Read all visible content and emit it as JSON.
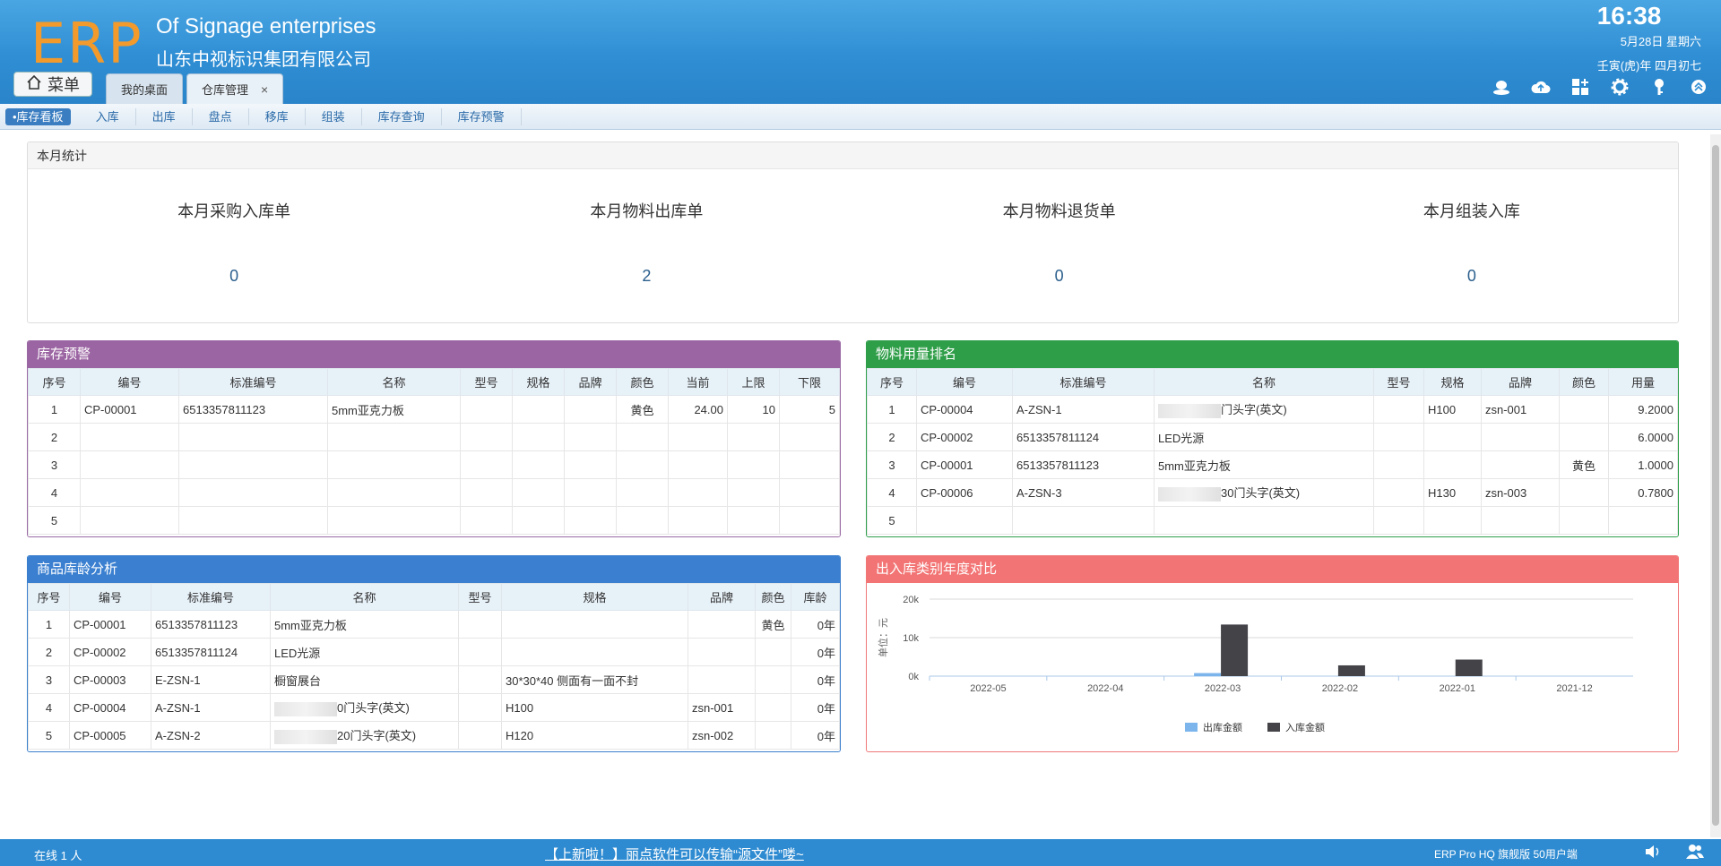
{
  "header": {
    "logo": "ERP",
    "company_en": "Of Signage enterprises",
    "company_cn": "山东中视标识集团有限公司",
    "time": "16:38",
    "date": "5月28日 星期六",
    "lunar": "壬寅(虎)年 四月初七",
    "menu_label": "菜单",
    "tabs": [
      {
        "label": "我的桌面"
      },
      {
        "label": "仓库管理",
        "close": "×"
      }
    ],
    "tool_icons": [
      "user-icon",
      "cloud-upload-icon",
      "grid-plus-icon",
      "gear-icon",
      "key-icon",
      "collapse-icon"
    ]
  },
  "subnav": {
    "items": [
      "•库存看板",
      "入库",
      "出库",
      "盘点",
      "移库",
      "组装",
      "库存查询",
      "库存预警"
    ]
  },
  "stats": {
    "title": "本月统计",
    "items": [
      {
        "label": "本月采购入库单",
        "value": "0"
      },
      {
        "label": "本月物料出库单",
        "value": "2"
      },
      {
        "label": "本月物料退货单",
        "value": "0"
      },
      {
        "label": "本月组装入库",
        "value": "0"
      }
    ]
  },
  "warning": {
    "title": "库存预警",
    "headers": [
      "序号",
      "编号",
      "标准编号",
      "名称",
      "型号",
      "规格",
      "品牌",
      "颜色",
      "当前",
      "上限",
      "下限"
    ],
    "rows": [
      [
        "1",
        "CP-00001",
        "6513357811123",
        "5mm亚克力板",
        "",
        "",
        "",
        "黄色",
        "24.00",
        "10",
        "5"
      ],
      [
        "2",
        "",
        "",
        "",
        "",
        "",
        "",
        "",
        "",
        "",
        ""
      ],
      [
        "3",
        "",
        "",
        "",
        "",
        "",
        "",
        "",
        "",
        "",
        ""
      ],
      [
        "4",
        "",
        "",
        "",
        "",
        "",
        "",
        "",
        "",
        "",
        ""
      ],
      [
        "5",
        "",
        "",
        "",
        "",
        "",
        "",
        "",
        "",
        "",
        ""
      ]
    ]
  },
  "ranking": {
    "title": "物料用量排名",
    "headers": [
      "序号",
      "编号",
      "标准编号",
      "名称",
      "型号",
      "规格",
      "品牌",
      "颜色",
      "用量"
    ],
    "rows": [
      [
        "1",
        "CP-00004",
        "A-ZSN-1",
        "门头字(英文)",
        "",
        "H100",
        "zsn-001",
        "",
        "9.2000"
      ],
      [
        "2",
        "CP-00002",
        "6513357811124",
        "LED光源",
        "",
        "",
        "",
        "",
        "6.0000"
      ],
      [
        "3",
        "CP-00001",
        "6513357811123",
        "5mm亚克力板",
        "",
        "",
        "",
        "黄色",
        "1.0000"
      ],
      [
        "4",
        "CP-00006",
        "A-ZSN-3",
        "30门头字(英文)",
        "",
        "H130",
        "zsn-003",
        "",
        "0.7800"
      ],
      [
        "5",
        "",
        "",
        "",
        "",
        "",
        "",
        "",
        ""
      ]
    ]
  },
  "age": {
    "title": "商品库龄分析",
    "headers": [
      "序号",
      "编号",
      "标准编号",
      "名称",
      "型号",
      "规格",
      "品牌",
      "颜色",
      "库龄"
    ],
    "rows": [
      [
        "1",
        "CP-00001",
        "6513357811123",
        "5mm亚克力板",
        "",
        "",
        "",
        "黄色",
        "0年"
      ],
      [
        "2",
        "CP-00002",
        "6513357811124",
        "LED光源",
        "",
        "",
        "",
        "",
        "0年"
      ],
      [
        "3",
        "CP-00003",
        "E-ZSN-1",
        "橱窗展台",
        "",
        "30*30*40 侧面有一面不封",
        "",
        "",
        "0年"
      ],
      [
        "4",
        "CP-00004",
        "A-ZSN-1",
        "0门头字(英文)",
        "",
        "H100",
        "zsn-001",
        "",
        "0年"
      ],
      [
        "5",
        "CP-00005",
        "A-ZSN-2",
        "20门头字(英文)",
        "",
        "H120",
        "zsn-002",
        "",
        "0年"
      ]
    ]
  },
  "chart_panel": {
    "title": "出入库类别年度对比"
  },
  "chart_data": {
    "type": "bar",
    "categories": [
      "2022-05",
      "2022-04",
      "2022-03",
      "2022-02",
      "2022-01",
      "2021-12"
    ],
    "series": [
      {
        "name": "出库金额",
        "color": "#7cb5ec",
        "values": [
          0,
          0,
          800,
          0,
          0,
          0
        ]
      },
      {
        "name": "入库金额",
        "color": "#434348",
        "values": [
          0,
          0,
          13400,
          2800,
          4300,
          0
        ]
      }
    ],
    "ylabel": "单位：元",
    "yticks": [
      "0k",
      "10k",
      "20k"
    ],
    "ylim": [
      0,
      20000
    ],
    "grid": true,
    "legend": "bottom"
  },
  "footer": {
    "online": "在线  1  人",
    "notice": "【上新啦！】丽点软件可以传输“源文件”喽~",
    "edition": "ERP Pro HQ 旗舰版 50用户端"
  }
}
